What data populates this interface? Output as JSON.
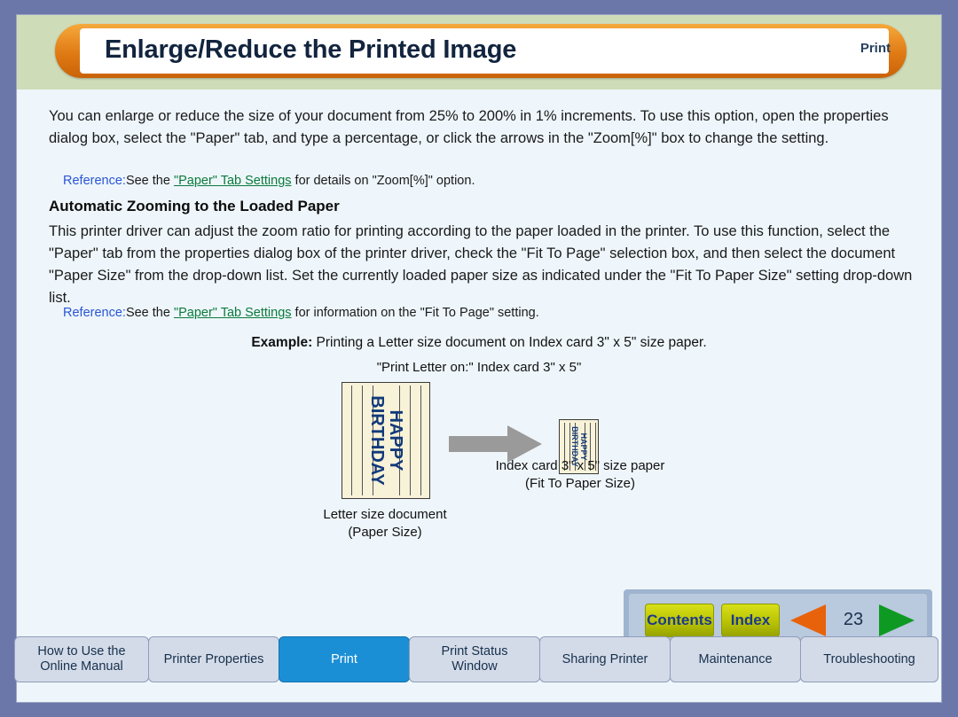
{
  "header": {
    "title": "Enlarge/Reduce the Printed Image",
    "right_label": "Print"
  },
  "body": {
    "paragraph1": "You can enlarge or reduce the size of your document from 25% to 200% in 1% increments. To use this option, open the properties dialog box, select the \"Paper\" tab, and type a percentage, or click the arrows in the \"Zoom[%]\" box to change the setting.",
    "reference1": {
      "label": "Reference:",
      "pre": "See the ",
      "link": "\"Paper\" Tab Settings",
      "post": " for details on \"Zoom[%]\" option."
    },
    "subheading": "Automatic Zooming to the Loaded Paper",
    "paragraph2": "This printer driver can adjust the zoom ratio for printing according to the paper loaded in the printer. To use this function, select the \"Paper\" tab from the properties dialog box of the printer driver, check the \"Fit To Page\" selection box, and then select the document \"Paper Size\" from the drop-down list. Set the currently loaded paper size as indicated under the \"Fit To Paper Size\" setting drop-down list.",
    "reference2": {
      "label": "Reference:",
      "pre": "See the ",
      "link": "\"Paper\" Tab Settings",
      "post": " for information on the \"Fit To Page\" setting."
    },
    "example_label": "Example:",
    "example_text": " Printing a Letter size document on Index card 3\" x 5\" size paper.",
    "print_letter_on": "\"Print Letter on:\" Index card 3\" x 5\""
  },
  "illustration": {
    "big_doc_line1": "HAPPY",
    "big_doc_line2": "BIRTHDAY",
    "small_doc_line1": "HAPPY",
    "small_doc_line2": "BIRTHDAY",
    "caption_left_line1": "Letter size document",
    "caption_left_line2": "(Paper Size)",
    "caption_right_line1": "Index card 3\" x 5\" size paper",
    "caption_right_line2": "(Fit To Paper Size)"
  },
  "nav": {
    "contents": "Contents",
    "index": "Index",
    "page_number": "23"
  },
  "tabs": [
    {
      "label_line1": "How to Use the",
      "label_line2": "Online Manual",
      "active": false
    },
    {
      "label_line1": "Printer Properties",
      "label_line2": "",
      "active": false
    },
    {
      "label_line1": "Print",
      "label_line2": "",
      "active": true
    },
    {
      "label_line1": "Print Status",
      "label_line2": "Window",
      "active": false
    },
    {
      "label_line1": "Sharing Printer",
      "label_line2": "",
      "active": false
    },
    {
      "label_line1": "Maintenance",
      "label_line2": "",
      "active": false
    },
    {
      "label_line1": "Troubleshooting",
      "label_line2": "",
      "active": false
    }
  ],
  "colors": {
    "accent_orange": "#e07a14",
    "active_tab": "#1b8fd6",
    "link_green": "#0a7a3c",
    "reference_blue": "#2a55d6"
  }
}
